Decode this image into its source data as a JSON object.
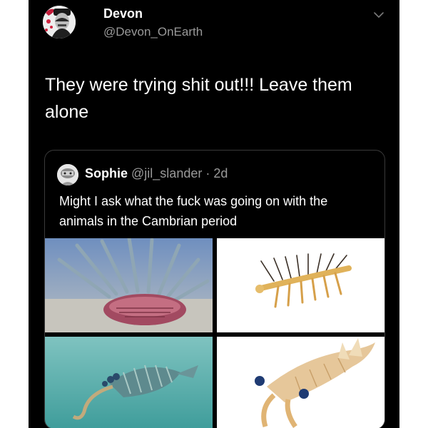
{
  "tweet": {
    "author": {
      "name": "Devon",
      "handle": "@Devon_OnEarth",
      "avatar_icon": "user-avatar-icon"
    },
    "text": "They were trying shit out!!! Leave them alone",
    "menu_icon": "chevron-down-icon"
  },
  "quote": {
    "author": {
      "name": "Sophie",
      "handle": "@jil_slander",
      "separator": "·",
      "time": "2d",
      "avatar_icon": "user-avatar-icon"
    },
    "text": "Might I ask what the fuck was going on with the animals in the Cambrian period",
    "images": [
      {
        "name": "spiky-cambrian-creature-image"
      },
      {
        "name": "hallucigenia-illustration-image"
      },
      {
        "name": "opabinia-underwater-image"
      },
      {
        "name": "anomalocaris-illustration-image"
      }
    ]
  },
  "colors": {
    "background": "#000000",
    "text": "#ffffff",
    "secondary_text": "#9a9a9a",
    "border": "#3a3a3a"
  }
}
